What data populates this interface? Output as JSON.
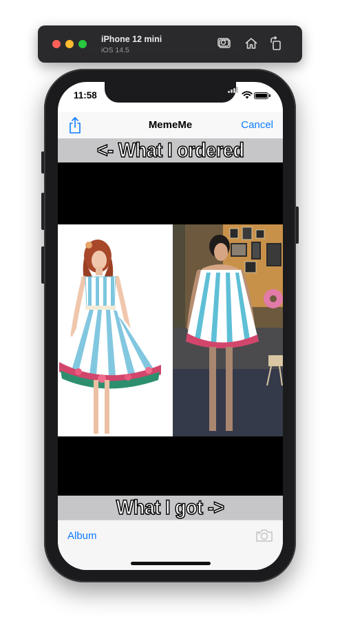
{
  "simulator": {
    "device_name": "iPhone 12 mini",
    "os_version": "iOS 14.5",
    "icons": [
      "screenshot-icon",
      "home-icon",
      "rotate-icon"
    ]
  },
  "status_bar": {
    "time": "11:58"
  },
  "nav": {
    "title": "MemeMe",
    "cancel_label": "Cancel",
    "share_icon": "share-icon"
  },
  "meme": {
    "top_text": "<- What I ordered",
    "bottom_text": "What I got ->"
  },
  "toolbar": {
    "album_label": "Album",
    "camera_icon": "camera-icon"
  },
  "colors": {
    "accent": "#0a7aff",
    "meme_band": "#c6c6c8"
  }
}
